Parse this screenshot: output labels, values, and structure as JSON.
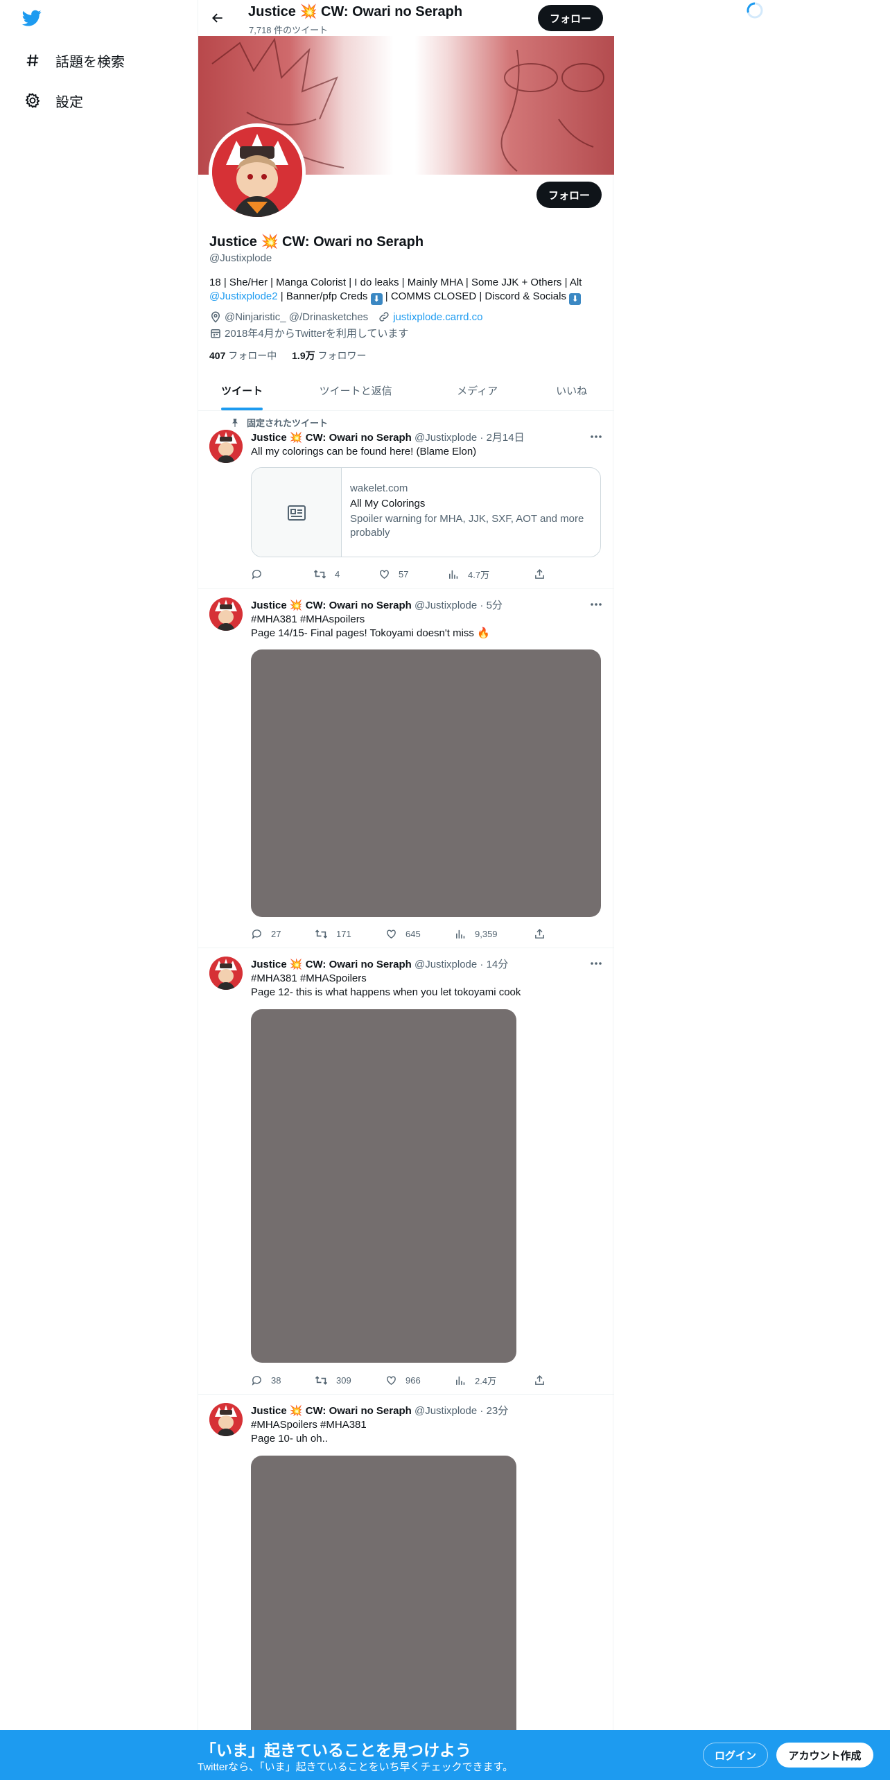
{
  "nav": {
    "items": [
      {
        "label": "話題を検索",
        "icon": "hashtag-icon"
      },
      {
        "label": "設定",
        "icon": "gear-icon"
      }
    ]
  },
  "header": {
    "title": "Justice 💥 CW: Owari no Seraph",
    "tweet_count": "7,718 件のツイート",
    "follow_label": "フォロー"
  },
  "profile": {
    "follow_label": "フォロー",
    "name": "Justice 💥 CW: Owari no Seraph",
    "handle": "@Justixplode",
    "bio_line1": "18 | She/Her | Manga Colorist | I do leaks | Mainly MHA | Some JJK + Others | Alt",
    "bio_link": "@Justixplode2",
    "bio_line2a": " | Banner/pfp Creds ",
    "bio_line2b": " | COMMS CLOSED | Discord & Socials ",
    "arrow_glyph": "⬇",
    "location": "@Ninjaristic_ @/Drinasketches",
    "website": "justixplode.carrd.co",
    "joined": "2018年4月からTwitterを利用しています",
    "following_count": "407",
    "following_label": " フォロー中",
    "followers_count": "1.9万",
    "followers_label": " フォロワー"
  },
  "tabs": [
    "ツイート",
    "ツイートと返信",
    "メディア",
    "いいね"
  ],
  "tweets": [
    {
      "pinned_label": "固定されたツイート",
      "name": "Justice 💥 CW: Owari no Seraph",
      "meta": " @Justixplode · 2月14日",
      "text": "All my colorings can be found here! (Blame Elon)",
      "card": {
        "domain": "wakelet.com",
        "title": "All My Colorings",
        "desc": "Spoiler warning for MHA, JJK, SXF, AOT and more probably"
      },
      "replies": "",
      "retweets": "4",
      "likes": "57",
      "views": "4.7万"
    },
    {
      "name": "Justice 💥 CW: Owari no Seraph",
      "meta": " @Justixplode · 5分",
      "hashtags": "#MHA381 #MHAspoilers",
      "text": "Page 14/15- Final pages! Tokoyami doesn't miss 🔥",
      "replies": "27",
      "retweets": "171",
      "likes": "645",
      "views": "9,359"
    },
    {
      "name": "Justice 💥 CW: Owari no Seraph",
      "meta": " @Justixplode · 14分",
      "hashtags": "#MHA381 #MHASpoilers",
      "text": "Page 12- this is what happens when you let tokoyami cook",
      "replies": "38",
      "retweets": "309",
      "likes": "966",
      "views": "2.4万"
    },
    {
      "name": "Justice 💥 CW: Owari no Seraph",
      "meta": " @Justixplode · 23分",
      "hashtags": "#MHASpoilers #MHA381",
      "text": "Page 10- uh oh.."
    }
  ],
  "bottombar": {
    "title": "「いま」起きていることを見つけよう",
    "subtitle": "Twitterなら、「いま」起きていることをいち早くチェックできます。",
    "login_label": "ログイン",
    "signup_label": "アカウント作成"
  },
  "colors": {
    "accent": "#1d9bf0",
    "dark": "#0f1419",
    "muted": "#536471",
    "media_placeholder": "#746e6e"
  }
}
